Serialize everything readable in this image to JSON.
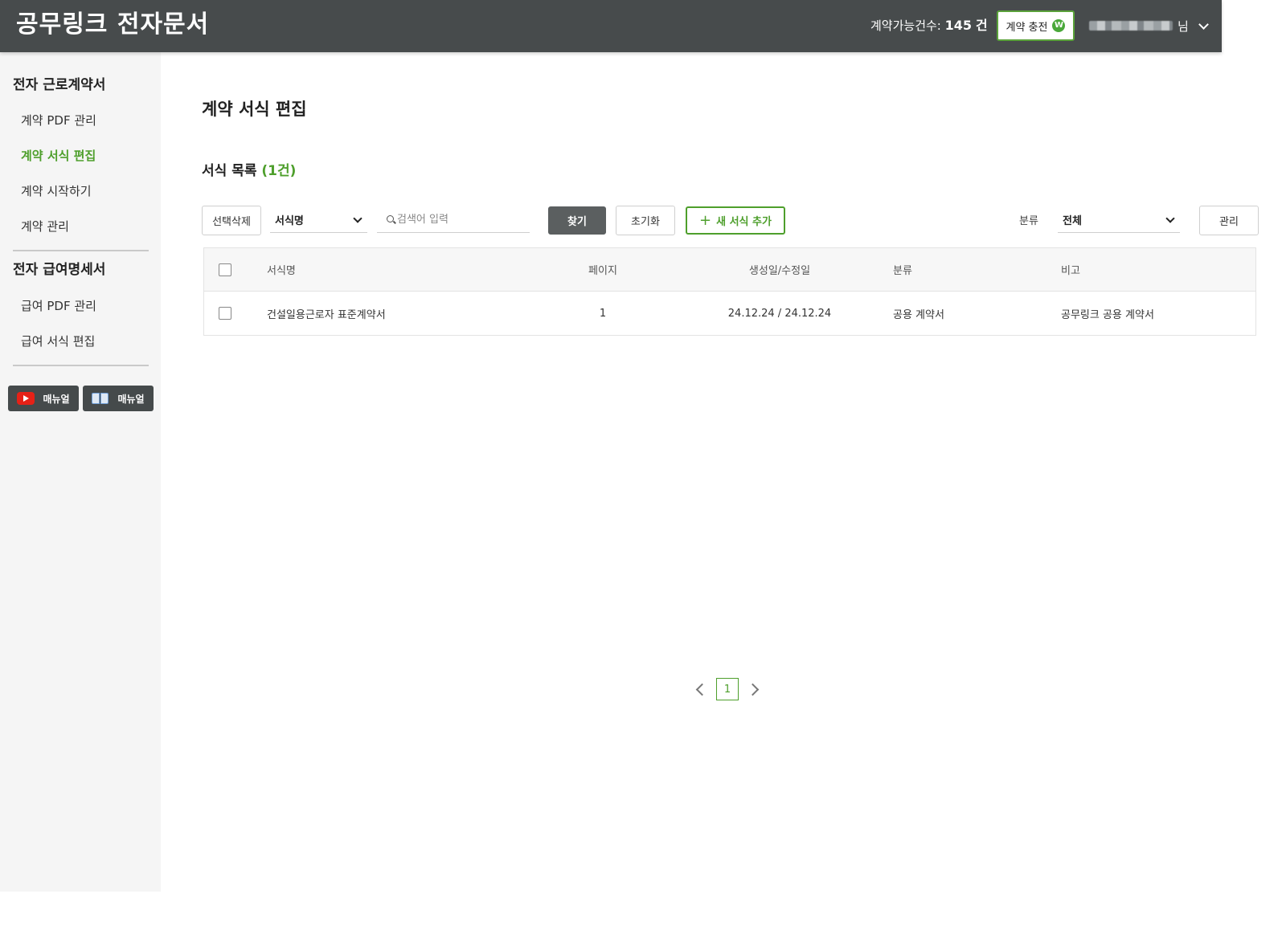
{
  "header": {
    "logo": "공무링크 전자문서",
    "quota_label": "계약가능건수:",
    "quota_count": "145",
    "quota_unit": "건",
    "charge_button": "계약 충전",
    "charge_icon": "W",
    "user_suffix": "님"
  },
  "sidebar": {
    "section1_title": "전자 근로계약서",
    "section1_items": [
      "계약 PDF 관리",
      "계약 서식 편집",
      "계약 시작하기",
      "계약 관리"
    ],
    "section2_title": "전자 급여명세서",
    "section2_items": [
      "급여 PDF 관리",
      "급여 서식 편집"
    ],
    "manual_video": "매뉴얼",
    "manual_book": "매뉴얼"
  },
  "main": {
    "page_title": "계약 서식 편집",
    "list_title": "서식 목록",
    "list_count": "(1건)",
    "toolbar": {
      "delete_button": "선택삭제",
      "search_field_select": "서식명",
      "search_placeholder": "검색어 입력",
      "find_button": "찾기",
      "reset_button": "초기화",
      "add_button": "새 서식 추가",
      "category_label": "분류",
      "category_select": "전체",
      "manage_button": "관리"
    },
    "table": {
      "headers": [
        "서식명",
        "페이지",
        "생성일/수정일",
        "분류",
        "비고"
      ],
      "rows": [
        {
          "name": "건설일용근로자 표준계약서",
          "pages": "1",
          "dates": "24.12.24 / 24.12.24",
          "category": "공용 계약서",
          "note": "공무링크 공용 계약서"
        }
      ]
    },
    "pagination": {
      "current_page": "1"
    }
  },
  "colors": {
    "header_bg": "#474b4c",
    "accent_green": "#4e9f2c",
    "sidebar_bg": "#f5f5f5"
  }
}
